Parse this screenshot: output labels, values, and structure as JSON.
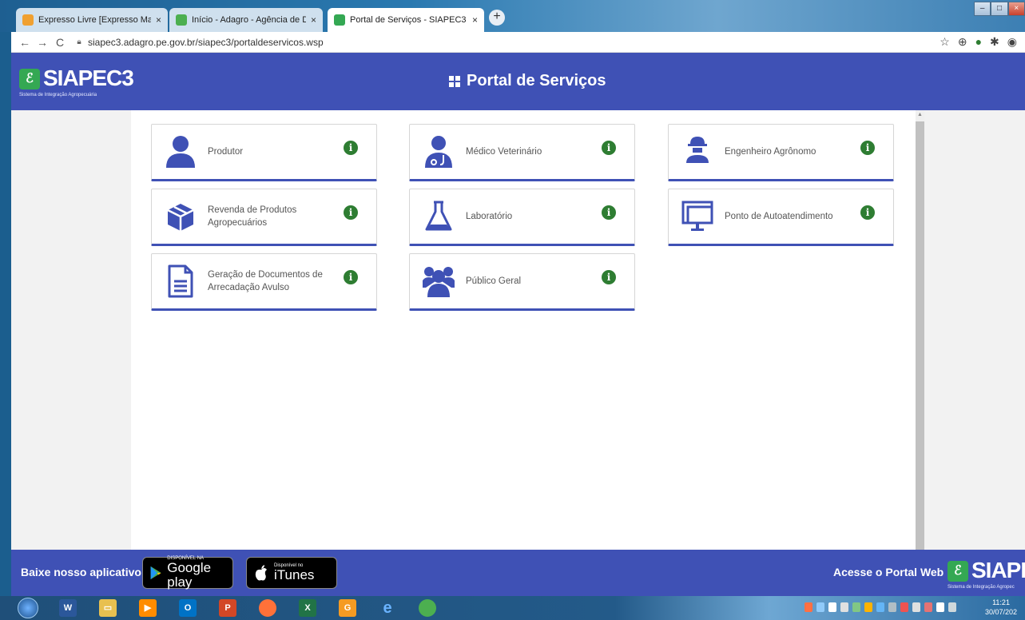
{
  "browser": {
    "tabs": [
      {
        "label": "Expresso Livre [Expresso Mail]",
        "close": "×",
        "icon_color": "#f0a030",
        "active": false
      },
      {
        "label": "Início - Adagro - Agência de Defe",
        "close": "×",
        "icon_color": "#4caf50",
        "active": false
      },
      {
        "label": "Portal de Serviços - SIAPEC3",
        "close": "×",
        "icon_color": "#34a853",
        "active": true
      }
    ],
    "new_tab": "+",
    "url": "siapec3.adagro.pe.gov.br/siapec3/portaldeservicos.wsp",
    "back": "←",
    "forward": "→",
    "reload": "C"
  },
  "header": {
    "logo_text": "SIAPEC3",
    "logo_subtitle": "Sistema de Integração Agropecuária",
    "title": "Portal de Serviços"
  },
  "cards": [
    {
      "label": "Produtor",
      "icon": "user-icon"
    },
    {
      "label": "Médico Veterinário",
      "icon": "doctor-icon"
    },
    {
      "label": "Engenheiro Agrônomo",
      "icon": "hardhat-worker-icon"
    },
    {
      "label": "Revenda de Produtos Agropecuários",
      "icon": "box-icon"
    },
    {
      "label": "Laboratório",
      "icon": "flask-icon"
    },
    {
      "label": "Ponto de Autoatendimento",
      "icon": "monitor-icon"
    },
    {
      "label": "Geração de Documentos de Arrecadação Avulso",
      "icon": "document-icon"
    },
    {
      "label": "Público Geral",
      "icon": "users-icon"
    }
  ],
  "info_glyph": "i",
  "footer": {
    "download_label": "Baixe nosso aplicativo",
    "google_small": "DISPONÍVEL NA",
    "google_big": "Google play",
    "apple_small": "Disponível no",
    "apple_big": "iTunes",
    "portal_label": "Acesse o Portal Web",
    "logo_text": "SIAPEC",
    "logo_subtitle": "Sistema de Integração Agropec"
  },
  "taskbar": {
    "time": "11:21",
    "date": "30/07/202"
  },
  "colors": {
    "primary": "#3f51b5",
    "info": "#2e7d32"
  }
}
